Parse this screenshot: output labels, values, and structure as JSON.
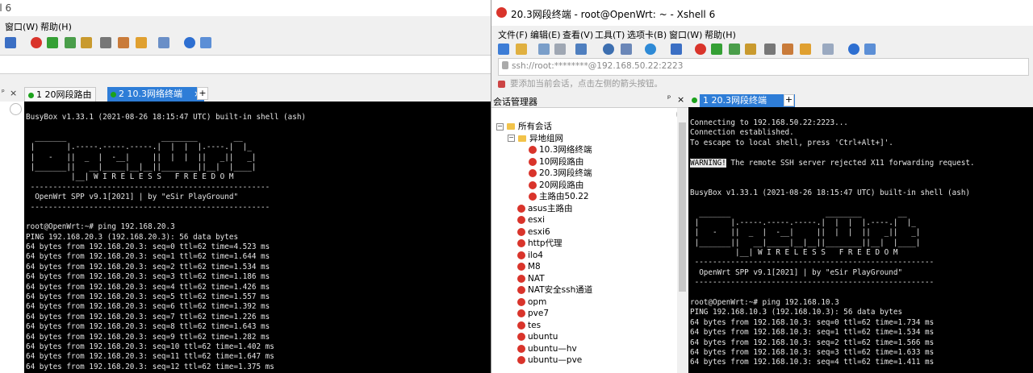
{
  "left_window": {
    "title_fragment": "ll 6",
    "menu": [
      "窗口(W)",
      "帮助(H)"
    ],
    "tabs": [
      {
        "label": "1 20网段路由",
        "active": false
      },
      {
        "label": "2 10.3网络终端",
        "active": true
      }
    ],
    "terminal_lines": [
      "BusyBox v1.33.1 (2021-08-26 18:15:47 UTC) built-in shell (ash)",
      "",
      "  _______                     ________        __",
      " |       |.-----.-----.-----.|  |  |  |.----.|  |_",
      " |   -   ||  _  |  -__|     ||  |  |  ||   _||   _|",
      " |_______||   __|_____|__|__||________||__|  |____|",
      "          |__| W I R E L E S S   F R E E D O M",
      " -----------------------------------------------------",
      "  OpenWrt SPP v9.1[2021] | by \"eSir PlayGround\"",
      " -----------------------------------------------------",
      "",
      "root@OpenWrt:~# ping 192.168.20.3",
      "PING 192.168.20.3 (192.168.20.3): 56 data bytes",
      "64 bytes from 192.168.20.3: seq=0 ttl=62 time=4.523 ms",
      "64 bytes from 192.168.20.3: seq=1 ttl=62 time=1.644 ms",
      "64 bytes from 192.168.20.3: seq=2 ttl=62 time=1.534 ms",
      "64 bytes from 192.168.20.3: seq=3 ttl=62 time=1.186 ms",
      "64 bytes from 192.168.20.3: seq=4 ttl=62 time=1.426 ms",
      "64 bytes from 192.168.20.3: seq=5 ttl=62 time=1.557 ms",
      "64 bytes from 192.168.20.3: seq=6 ttl=62 time=1.392 ms",
      "64 bytes from 192.168.20.3: seq=7 ttl=62 time=1.226 ms",
      "64 bytes from 192.168.20.3: seq=8 ttl=62 time=1.643 ms",
      "64 bytes from 192.168.20.3: seq=9 ttl=62 time=1.282 ms",
      "64 bytes from 192.168.20.3: seq=10 ttl=62 time=1.402 ms",
      "64 bytes from 192.168.20.3: seq=11 ttl=62 time=1.647 ms",
      "64 bytes from 192.168.20.3: seq=12 ttl=62 time=1.375 ms"
    ]
  },
  "right_window": {
    "title": "20.3网段终端 - root@OpenWrt: ~ - Xshell 6",
    "menu": [
      "文件(F)",
      "编辑(E)",
      "查看(V)",
      "工具(T)",
      "选项卡(B)",
      "窗口(W)",
      "帮助(H)"
    ],
    "address": "ssh://root:********@192.168.50.22:2223",
    "hint": "要添加当前会话，点击左侧的箭头按钮。",
    "session_manager": {
      "title": "会话管理器",
      "pin": "ᵖ",
      "close": "×",
      "root": "所有会话",
      "group": "异地组网",
      "group_items": [
        "10.3网络终端",
        "10网段路由",
        "20.3网段终端",
        "20网段路由",
        "主路由50.22"
      ],
      "items": [
        "asus主路由",
        "esxi",
        "esxi6",
        "http代理",
        "ilo4",
        "M8",
        "NAT",
        "NAT安全ssh通道",
        "opm",
        "pve7",
        "tes",
        "ubuntu",
        "ubuntu—hv",
        "ubuntu—pve"
      ]
    },
    "tabs": [
      {
        "label": "1 20.3网段终端",
        "active": true
      }
    ],
    "terminal_lines": [
      "Connecting to 192.168.50.22:2223...",
      "Connection established.",
      "To escape to local shell, press 'Ctrl+Alt+]'.",
      "",
      "WARNING!",
      "",
      "",
      "BusyBox v1.33.1 (2021-08-26 18:15:47 UTC) built-in shell (ash)",
      "",
      "  _______                     ________        __",
      " |       |.-----.-----.-----.|  |  |  |.----.|  |_",
      " |   -   ||  _  |  -__|     ||  |  |  ||   _||   _|",
      " |_______||   __|_____|__|__||________||__|  |____|",
      "          |__| W I R E L E S S   F R E E D O M",
      " -----------------------------------------------------",
      "  OpenWrt SPP v9.1[2021] | by \"eSir PlayGround\"",
      " -----------------------------------------------------",
      "",
      "root@OpenWrt:~# ping 192.168.10.3",
      "PING 192.168.10.3 (192.168.10.3): 56 data bytes",
      "64 bytes from 192.168.10.3: seq=0 ttl=62 time=1.734 ms",
      "64 bytes from 192.168.10.3: seq=1 ttl=62 time=1.534 ms",
      "64 bytes from 192.168.10.3: seq=2 ttl=62 time=1.566 ms",
      "64 bytes from 192.168.10.3: seq=3 ttl=62 time=1.633 ms",
      "64 bytes from 192.168.10.3: seq=4 ttl=62 time=1.411 ms"
    ],
    "warning_text": " The remote SSH server rejected X11 forwarding request."
  },
  "colors": {
    "tab_active": "#2e7dd7",
    "terminal_bg": "#000000",
    "terminal_fg": "#e6e6e6",
    "session_icon": "#d9342b"
  }
}
